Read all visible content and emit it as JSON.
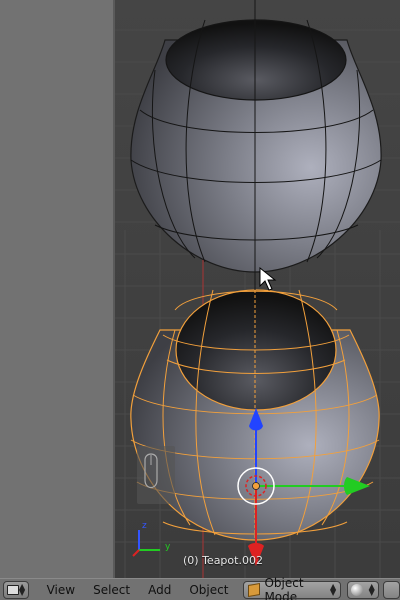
{
  "viewport": {
    "object_info": "(0) Teapot.002"
  },
  "header": {
    "menus": [
      "View",
      "Select",
      "Add",
      "Object"
    ],
    "mode": "Object Mode",
    "icons": {
      "editor_type": "3d-view-icon",
      "mode": "cube-icon",
      "shading": "sphere-icon",
      "pivot": "pivot-icon"
    }
  },
  "colors": {
    "selection_wire": "#f2a03c",
    "mesh_wire": "#141414",
    "axis_x": "#22cc22",
    "axis_y": "#2244ff",
    "axis_z": "#dd2222"
  }
}
